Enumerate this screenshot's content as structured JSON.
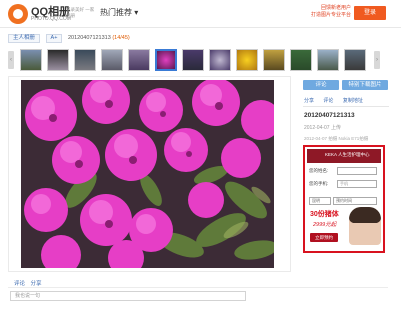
{
  "header": {
    "logo": "QQ相册",
    "logo_sub": "PHOTO.QQ.COM",
    "slogan": "记录美好 一家相册",
    "hot_menu": "热门推荐",
    "promo": "回馈新老用户\n打造图片专业平台",
    "promo_button": "登录"
  },
  "breadcrumb": {
    "user": "主人相册",
    "album": "A+",
    "photo": "20120407121313",
    "count": "(14/45)"
  },
  "thumbnails": {
    "count": 13,
    "selected_index": 5,
    "prev_icon": "chevron-left-icon",
    "next_icon": "chevron-right-icon"
  },
  "photo": {
    "subject": "azalea"
  },
  "info": {
    "comment_button": "评论",
    "download_button": "特别下载图片",
    "links": [
      "分享",
      "评论",
      "复制地址"
    ],
    "title": "20120407121313",
    "date": "2012-04-07 上传",
    "meta": "2012-04-07 拍摄 Nokia E71拍摄"
  },
  "ad": {
    "brand": "KEKA 人生活护理中心",
    "field_name_label": "您的姓名:",
    "field_phone_label": "您的手机:",
    "phone_placeholder": "手机",
    "select_1": "昆明",
    "select_2": "预约时间",
    "price_1": "30份猪体",
    "price_2": "2999元起",
    "button": "立即预约"
  },
  "comments": {
    "links": [
      "评论",
      "分享"
    ],
    "input_placeholder": "我也说一句"
  },
  "colors": {
    "accent": "#f05a20",
    "link": "#3a69b0",
    "ad_border": "#d8121f"
  }
}
